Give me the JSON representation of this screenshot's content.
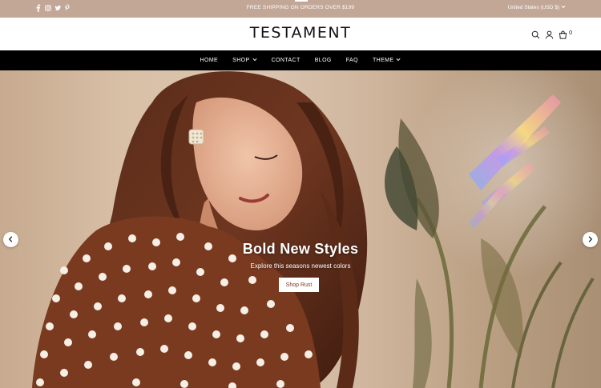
{
  "announcement": {
    "text": "FREE SHIPPING ON ORDERS OVER $199",
    "currency": "United States (USD $)"
  },
  "socials": [
    "facebook-icon",
    "instagram-icon",
    "twitter-icon",
    "pinterest-icon"
  ],
  "header": {
    "logo": "TESTAMENT",
    "cart_count": "0",
    "icons": [
      "search-icon",
      "account-icon",
      "cart-icon"
    ]
  },
  "nav": {
    "items": [
      {
        "label": "HOME"
      },
      {
        "label": "SHOP"
      },
      {
        "label": "CONTACT"
      },
      {
        "label": "BLOG"
      },
      {
        "label": "FAQ"
      },
      {
        "label": "THEME"
      }
    ]
  },
  "hero": {
    "title": "Bold New Styles",
    "subtitle": "Explore this seasons newest colors",
    "button": "Shop Rust"
  },
  "colors": {
    "announcement_bg": "#c2a797",
    "nav_bg": "#000000",
    "accent_rust": "#7a3a2a"
  }
}
